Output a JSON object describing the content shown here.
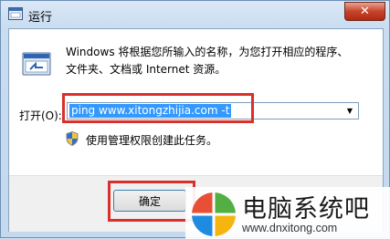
{
  "window": {
    "title": "运行",
    "close_label": "✕"
  },
  "description": {
    "line1": "Windows 将根据您所输入的名称，为您打开相应的程序、",
    "line2": "文件夹、文档或 Internet 资源。"
  },
  "open_label": "打开(O):",
  "command_input": {
    "value": "ping www.xitongzhijia.com -t"
  },
  "admin_note": "使用管理权限创建此任务。",
  "ok_button": "确定",
  "watermark": {
    "title": "电脑系统吧",
    "url": "www.dnxitong.com"
  },
  "colors": {
    "highlight_box": "#d9302c",
    "selection": "#3399ff"
  },
  "icons": [
    "run-program-icon",
    "shield-icon",
    "windows-logo-icon",
    "chevron-down-icon",
    "close-icon"
  ]
}
